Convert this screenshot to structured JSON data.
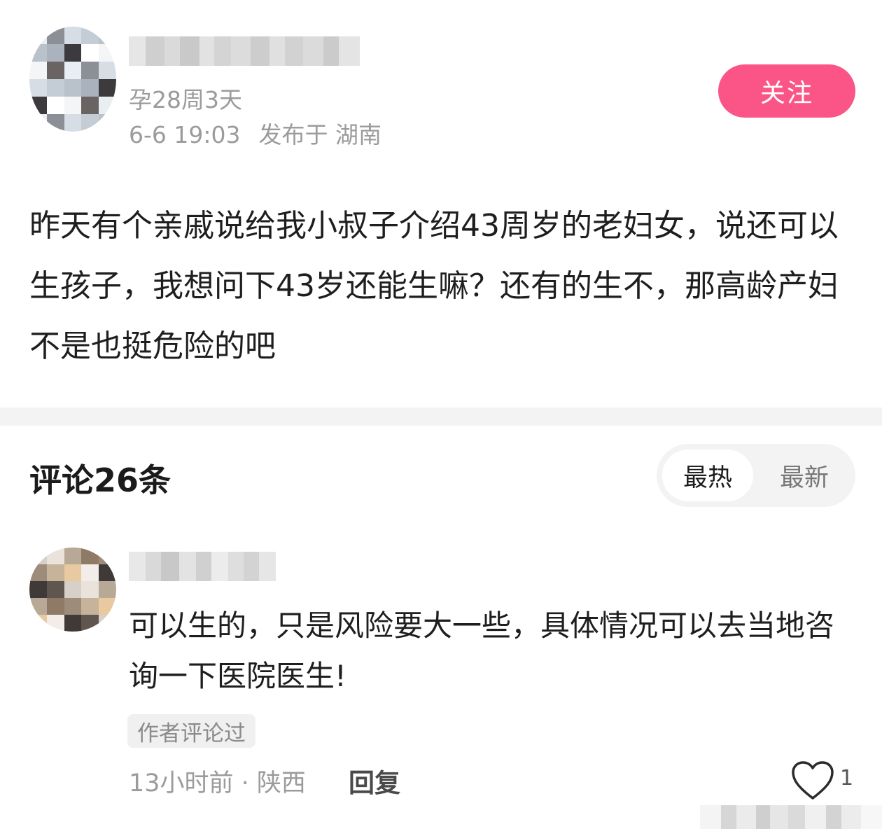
{
  "post": {
    "pregnancy_week": "孕28周3天",
    "date": "6-6 19:03",
    "location_label": "发布于 湖南",
    "follow_label": "关注",
    "body": "昨天有个亲戚说给我小叔子介绍43周岁的老妇女，说还可以生孩子，我想问下43岁还能生嘛？还有的生不，那高龄产妇不是也挺危险的吧"
  },
  "comments_section": {
    "title": "评论26条",
    "sort_options": [
      "最热",
      "最新"
    ],
    "active_sort": "最热"
  },
  "comment": {
    "text": "可以生的，只是风险要大一些，具体情况可以去当地咨询一下医院医生!",
    "badge": "作者评论过",
    "meta": "13小时前 · 陕西",
    "reply_label": "回复",
    "like_count": "1"
  },
  "colors": {
    "accent": "#fb5587",
    "meta_text": "#9b9b9b",
    "divider": "#f3f3f3"
  }
}
